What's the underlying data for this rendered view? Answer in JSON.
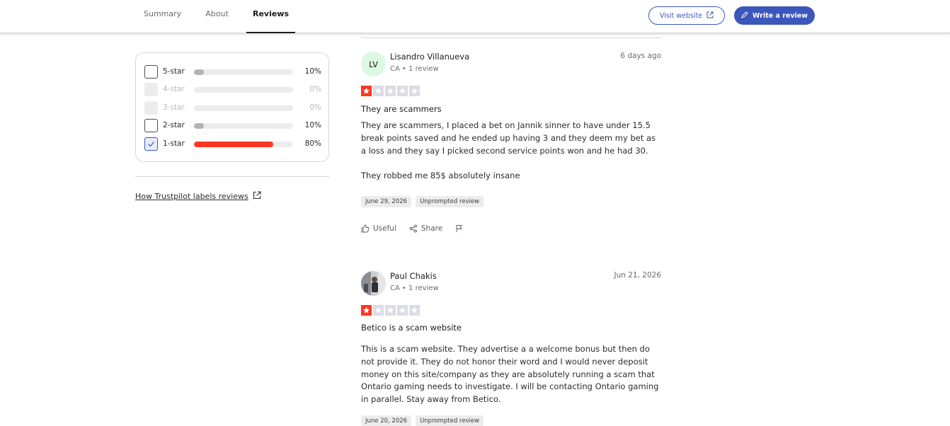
{
  "nav": {
    "tabs": [
      {
        "label": "Summary",
        "active": false
      },
      {
        "label": "About",
        "active": false
      },
      {
        "label": "Reviews",
        "active": true
      }
    ],
    "visit_label": "Visit website",
    "write_label": "Write a review",
    "accent_color": "#3c57bc"
  },
  "filter": {
    "rows": [
      {
        "label": "5-star",
        "percent": "10%",
        "fill_percent": 10,
        "disabled": false,
        "checked": false
      },
      {
        "label": "4-star",
        "percent": "0%",
        "fill_percent": 0,
        "disabled": true,
        "checked": false
      },
      {
        "label": "3-star",
        "percent": "0%",
        "fill_percent": 0,
        "disabled": true,
        "checked": false
      },
      {
        "label": "2-star",
        "percent": "10%",
        "fill_percent": 10,
        "disabled": false,
        "checked": false
      },
      {
        "label": "1-star",
        "percent": "80%",
        "fill_percent": 80,
        "disabled": false,
        "checked": true
      }
    ],
    "bar_color_default": "#b3b3b3",
    "bar_color_selected": "#ff3722",
    "how_link": "How Trustpilot labels reviews"
  },
  "reviews": [
    {
      "initials": "LV",
      "avatar_color": "#dcf9e3",
      "name": "Lisandro Villanueva",
      "meta": "CA • 1 review",
      "date": "6 days ago",
      "rating": 1,
      "title": "They are scammers",
      "body": [
        "They are scammers, I placed a bet on Jannik sinner to have under 15.5 break points saved and he ended up having 3 and they deem my bet as a loss and they say I picked second service points won and he had 30.",
        "They robbed me 85$ absolutely insane"
      ],
      "tags": [
        "June 29, 2026",
        "Unprompted review"
      ],
      "actions": {
        "useful": "Useful",
        "share": "Share"
      }
    },
    {
      "initials": "",
      "avatar_color": "#cfcfcf",
      "name": "Paul Chakis",
      "meta": "CA • 1 review",
      "date": "Jun 21, 2026",
      "rating": 1,
      "title": "Betico is a scam website",
      "body": [
        "This is a scam website. They advertise a a welcome bonus but then do not provide it. They do not honor their word and I would never deposit money on this site/company as they are absolutely running a scam that Ontario gaming needs to investigate. I will be contacting Ontario gaming in parallel. Stay away from Betico."
      ],
      "tags": [
        "June 20, 2026",
        "Unprompted review"
      ]
    }
  ],
  "star_colors": {
    "filled": "#ff3722",
    "empty": "#dcdce6"
  }
}
